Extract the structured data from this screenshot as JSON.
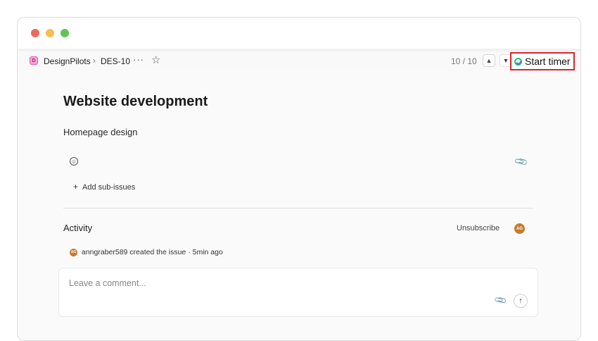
{
  "window": {
    "traffic_lights": [
      "close",
      "minimize",
      "maximize"
    ]
  },
  "toolbar": {
    "workspace_name": "DesignPilots",
    "workspace_icon_letter": "D",
    "separator": "›",
    "issue_id": "DES-10",
    "more_icon": "···",
    "star_icon": "☆",
    "counter": "10 / 10",
    "nav_up": "▲",
    "nav_down": "▼",
    "start_timer_label": "Start timer"
  },
  "issue": {
    "title": "Website development",
    "description": "Homepage design",
    "emoji_icon": "☺",
    "attach_icon": "📎",
    "add_sub_issues_label": "Add sub-issues",
    "add_icon": "+"
  },
  "activity": {
    "heading": "Activity",
    "unsubscribe_label": "Unsubscribe",
    "avatar_initials": "AG",
    "log": [
      {
        "user": "anngraber589",
        "text": "anngraber589 created the issue · 5min ago",
        "initials": "AG"
      }
    ]
  },
  "comment": {
    "placeholder": "Leave a comment...",
    "attach_icon": "📎",
    "send_icon": "↑"
  },
  "colors": {
    "accent_highlight": "#d9242b",
    "timer_green": "#2fbf6a",
    "avatar": "#c77b2b",
    "workspace_pink": "#f5a3d4"
  }
}
